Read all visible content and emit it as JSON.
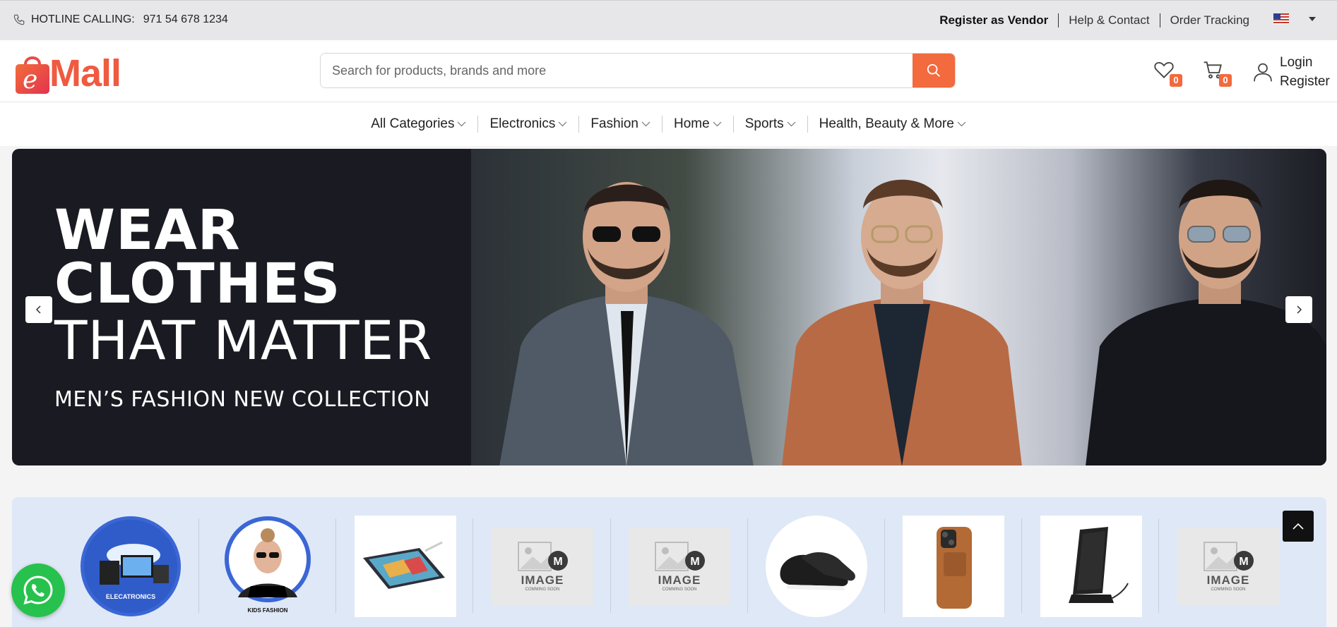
{
  "topbar": {
    "hotline_label": "HOTLINE CALLING:",
    "hotline_number": "971 54 678 1234",
    "links": [
      "Register as Vendor",
      "Help & Contact",
      "Order Tracking"
    ]
  },
  "header": {
    "logo_text": "Mall",
    "logo_initial": "e",
    "search_placeholder": "Search for products, brands and more",
    "wishlist_count": "0",
    "cart_count": "0",
    "login": "Login",
    "register": "Register"
  },
  "nav": {
    "items": [
      "All Categories",
      "Electronics",
      "Fashion",
      "Home",
      "Sports",
      "Health, Beauty & More"
    ]
  },
  "banner": {
    "line1": "WEAR",
    "line2": "CLOTHES",
    "line3": "THAT MATTER",
    "line4": "MEN’S FASHION NEW COLLECTION"
  },
  "categories": {
    "electronics_label": "ELECATRONICS",
    "kids_label": "KIDS FASHION",
    "placeholder_label": "IMAGE",
    "placeholder_sub": "COMMING SOON"
  },
  "colors": {
    "accent": "#f26a3d",
    "topbar_bg": "#e7e7e9",
    "category_strip_bg": "#dfe8f6",
    "whatsapp": "#27c14d"
  }
}
